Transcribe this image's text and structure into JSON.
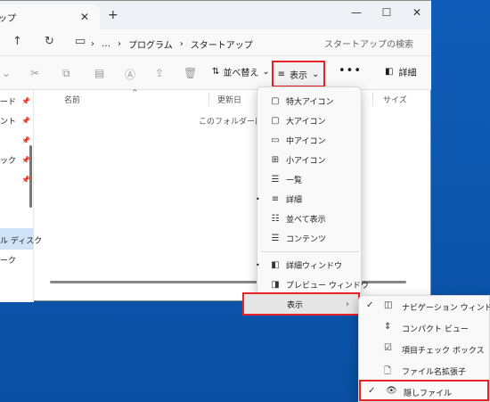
{
  "explorer": {
    "tab_title": "ップ",
    "tab_close": "✕",
    "new_tab": "+",
    "window_controls": {
      "minimize": "—",
      "maximize": "☐",
      "close": "✕"
    },
    "breadcrumb": [
      "…",
      "プログラム",
      "スタートアップ"
    ],
    "breadcrumb_sep": "›",
    "search_placeholder": "スタートアップの検索",
    "toolbar": {
      "sort_label": "並べ替え",
      "view_label": "表示",
      "more_label": "•••",
      "details_label": "詳細"
    },
    "nav_items": [
      "ード",
      "ント",
      "",
      "ック",
      "",
      "ル ディスク",
      "ーク"
    ],
    "columns": [
      "名前",
      "更新日",
      "サイズ"
    ],
    "empty_message": "このフォルダーは"
  },
  "view_menu": {
    "items": [
      {
        "label": "特大アイコン",
        "icon": "square-icon",
        "glyph": "▢",
        "selected": false
      },
      {
        "label": "大アイコン",
        "icon": "square-icon",
        "glyph": "▢",
        "selected": false
      },
      {
        "label": "中アイコン",
        "icon": "monitor-icon",
        "glyph": "▭",
        "selected": false
      },
      {
        "label": "小アイコン",
        "icon": "grid-icon",
        "glyph": "⊞",
        "selected": false
      },
      {
        "label": "一覧",
        "icon": "list-icon",
        "glyph": "☰",
        "selected": false
      },
      {
        "label": "詳細",
        "icon": "lines-icon",
        "glyph": "≡",
        "selected": true
      },
      {
        "label": "並べて表示",
        "icon": "tiles-icon",
        "glyph": "☷",
        "selected": false
      },
      {
        "label": "コンテンツ",
        "icon": "content-icon",
        "glyph": "☰",
        "selected": false
      },
      {
        "label": "詳細ウィンドウ",
        "icon": "details-pane-icon",
        "glyph": "◧",
        "selected": true
      },
      {
        "label": "プレビュー ウィンドウ",
        "icon": "preview-pane-icon",
        "glyph": "◨",
        "selected": false
      }
    ],
    "submenu_trigger": "表示",
    "chevron": "›"
  },
  "sub_menu": {
    "items": [
      {
        "label": "ナビゲーション ウィンドウ",
        "icon": "nav-pane-icon",
        "glyph": "◫",
        "checked": true
      },
      {
        "label": "コンパクト ビュー",
        "icon": "compact-icon",
        "glyph": "⇕",
        "checked": false
      },
      {
        "label": "項目チェック ボックス",
        "icon": "checkbox-icon",
        "glyph": "☑",
        "checked": false
      },
      {
        "label": "ファイル名拡張子",
        "icon": "file-icon",
        "glyph": "🗋",
        "checked": false
      },
      {
        "label": "隠しファイル",
        "icon": "eye-icon",
        "glyph": "👁",
        "checked": true
      }
    ],
    "check_glyph": "✓"
  },
  "colors": {
    "highlight_border": "#e52329",
    "desktop": "#0f5db8"
  }
}
